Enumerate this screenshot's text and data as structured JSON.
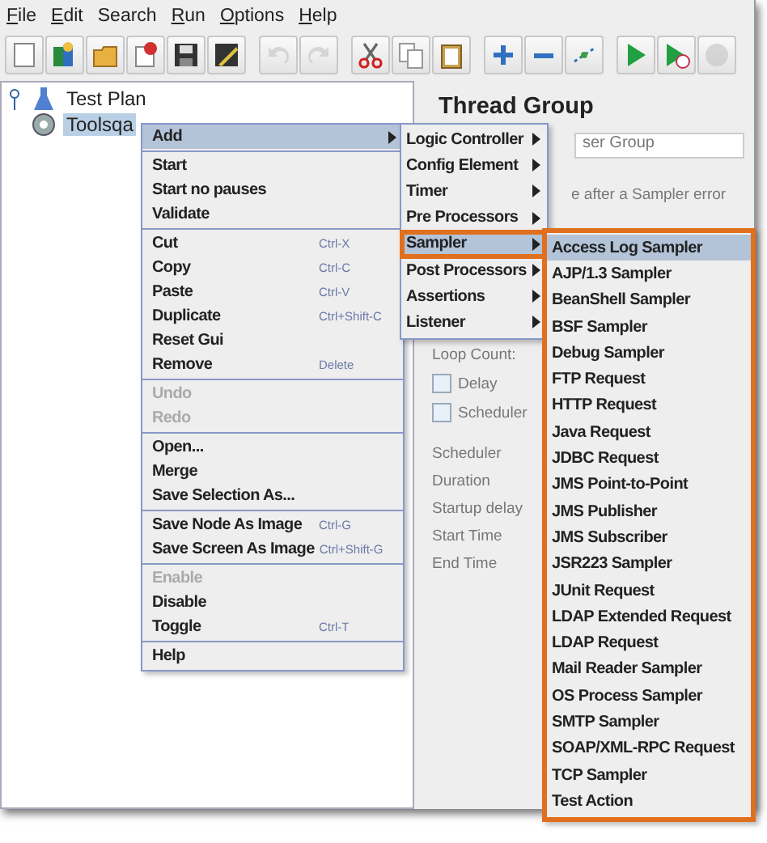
{
  "menu_bar": [
    {
      "label": "File",
      "underlined": true
    },
    {
      "label": "Edit",
      "underlined": true
    },
    {
      "label": "Search",
      "underlined": false
    },
    {
      "label": "Run",
      "underlined": true
    },
    {
      "label": "Options",
      "underlined": true
    },
    {
      "label": "Help",
      "underlined": true
    }
  ],
  "toolbar": {
    "groups": [
      [
        {
          "disabled": false
        },
        {
          "disabled": false
        },
        {
          "disabled": false
        },
        {
          "disabled": false
        },
        {
          "disabled": false
        },
        {
          "disabled": false
        }
      ],
      [
        {
          "disabled": true
        },
        {
          "disabled": true
        }
      ],
      [
        {
          "disabled": false
        },
        {
          "disabled": false
        },
        {
          "disabled": false
        }
      ],
      [
        {
          "disabled": false
        },
        {
          "disabled": false
        },
        {
          "disabled": false
        }
      ],
      [
        {
          "disabled": false
        },
        {
          "disabled": false
        },
        {
          "disabled": true
        }
      ]
    ]
  },
  "tree": [
    {
      "label": "Test Plan",
      "expanded": true,
      "selected": false,
      "children": [
        {
          "label": "Toolsqa",
          "selected": true
        }
      ]
    }
  ],
  "panel": {
    "title": "Thread Group",
    "name_value": "ser Group",
    "error_text": "e after a Sampler error",
    "loop_count": "Loop Count:",
    "delay_checked": false,
    "delay_label": "Delay",
    "scheduler_checked": false,
    "scheduler_label": "Scheduler",
    "scheduler_group": "Scheduler",
    "duration": "Duration",
    "startup": "Startup delay",
    "start_time": "Start Time",
    "end_time": "End Time"
  },
  "context_menu": [
    [
      {
        "label": "Add",
        "submenu": true,
        "selected": true,
        "disabled": false
      }
    ],
    [
      {
        "label": "Start",
        "submenu": false,
        "selected": false,
        "disabled": false
      },
      {
        "label": "Start no pauses",
        "submenu": false,
        "selected": false,
        "disabled": false
      },
      {
        "label": "Validate",
        "submenu": false,
        "selected": false,
        "disabled": false
      }
    ],
    [
      {
        "label": "Cut",
        "shortcut": "Ctrl-X",
        "submenu": false,
        "selected": false,
        "disabled": false
      },
      {
        "label": "Copy",
        "shortcut": "Ctrl-C",
        "submenu": false,
        "selected": false,
        "disabled": false
      },
      {
        "label": "Paste",
        "shortcut": "Ctrl-V",
        "submenu": false,
        "selected": false,
        "disabled": false
      },
      {
        "label": "Duplicate",
        "shortcut": "Ctrl+Shift-C",
        "submenu": false,
        "selected": false,
        "disabled": false
      },
      {
        "label": "Reset Gui",
        "submenu": false,
        "selected": false,
        "disabled": false
      },
      {
        "label": "Remove",
        "shortcut": "Delete",
        "submenu": false,
        "selected": false,
        "disabled": false
      }
    ],
    [
      {
        "label": "Undo",
        "submenu": false,
        "selected": false,
        "disabled": true
      },
      {
        "label": "Redo",
        "submenu": false,
        "selected": false,
        "disabled": true
      }
    ],
    [
      {
        "label": "Open...",
        "submenu": false,
        "selected": false,
        "disabled": false
      },
      {
        "label": "Merge",
        "submenu": false,
        "selected": false,
        "disabled": false
      },
      {
        "label": "Save Selection As...",
        "submenu": false,
        "selected": false,
        "disabled": false
      }
    ],
    [
      {
        "label": "Save Node As Image",
        "shortcut": "Ctrl-G",
        "submenu": false,
        "selected": false,
        "disabled": false
      },
      {
        "label": "Save Screen As Image",
        "shortcut": "Ctrl+Shift-G",
        "submenu": false,
        "selected": false,
        "disabled": false
      }
    ],
    [
      {
        "label": "Enable",
        "submenu": false,
        "selected": false,
        "disabled": true
      },
      {
        "label": "Disable",
        "submenu": false,
        "selected": false,
        "disabled": false
      },
      {
        "label": "Toggle",
        "shortcut": "Ctrl-T",
        "submenu": false,
        "selected": false,
        "disabled": false
      }
    ],
    [
      {
        "label": "Help",
        "submenu": false,
        "selected": false,
        "disabled": false
      }
    ]
  ],
  "add_submenu": [
    {
      "label": "Logic Controller",
      "selected": false
    },
    {
      "label": "Config Element",
      "selected": false
    },
    {
      "label": "Timer",
      "selected": false
    },
    {
      "label": "Pre Processors",
      "selected": false
    },
    {
      "label": "Sampler",
      "selected": true
    },
    {
      "label": "Post Processors",
      "selected": false
    },
    {
      "label": "Assertions",
      "selected": false
    },
    {
      "label": "Listener",
      "selected": false
    }
  ],
  "sampler_submenu": [
    {
      "label": "Access Log Sampler",
      "selected": true
    },
    {
      "label": "AJP/1.3 Sampler",
      "selected": false
    },
    {
      "label": "BeanShell Sampler",
      "selected": false
    },
    {
      "label": "BSF Sampler",
      "selected": false
    },
    {
      "label": "Debug Sampler",
      "selected": false
    },
    {
      "label": "FTP Request",
      "selected": false
    },
    {
      "label": "HTTP Request",
      "selected": false
    },
    {
      "label": "Java Request",
      "selected": false
    },
    {
      "label": "JDBC Request",
      "selected": false
    },
    {
      "label": "JMS Point-to-Point",
      "selected": false
    },
    {
      "label": "JMS Publisher",
      "selected": false
    },
    {
      "label": "JMS Subscriber",
      "selected": false
    },
    {
      "label": "JSR223 Sampler",
      "selected": false
    },
    {
      "label": "JUnit Request",
      "selected": false
    },
    {
      "label": "LDAP Extended Request",
      "selected": false
    },
    {
      "label": "LDAP Request",
      "selected": false
    },
    {
      "label": "Mail Reader Sampler",
      "selected": false
    },
    {
      "label": "OS Process Sampler",
      "selected": false
    },
    {
      "label": "SMTP Sampler",
      "selected": false
    },
    {
      "label": "SOAP/XML-RPC Request",
      "selected": false
    },
    {
      "label": "TCP Sampler",
      "selected": false
    },
    {
      "label": "Test Action",
      "selected": false
    }
  ]
}
